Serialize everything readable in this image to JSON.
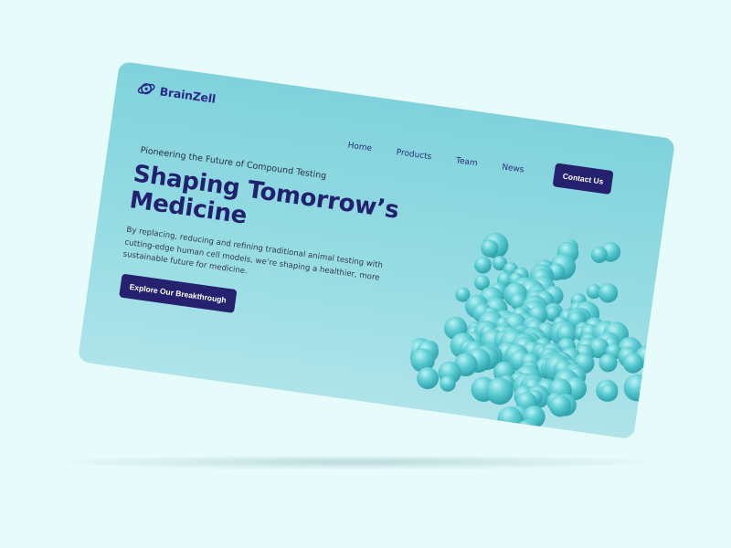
{
  "brand": {
    "name": "BrainZell",
    "logo_icon": "orbit-brain-icon"
  },
  "nav": {
    "items": [
      {
        "label": "Home"
      },
      {
        "label": "Products"
      },
      {
        "label": "Team"
      },
      {
        "label": "News"
      }
    ],
    "cta_label": "Contact Us"
  },
  "hero": {
    "eyebrow": "Pioneering the Future of Compound Testing",
    "title_line1": "Shaping Tomorrow’s",
    "title_line2": "Medicine",
    "body": "By replacing, reducing and refining traditional animal testing with cutting-edge human cell models, we’re shaping a healthier, more sustainable future for medicine.",
    "cta_label": "Explore Our Breakthrough",
    "image": "protein-molecule-illustration"
  },
  "colors": {
    "page_background": "#e7fbfb",
    "card_background": "#8ad7df",
    "brand_navy": "#25216e",
    "molecule_teal": "#5ccdd3"
  }
}
